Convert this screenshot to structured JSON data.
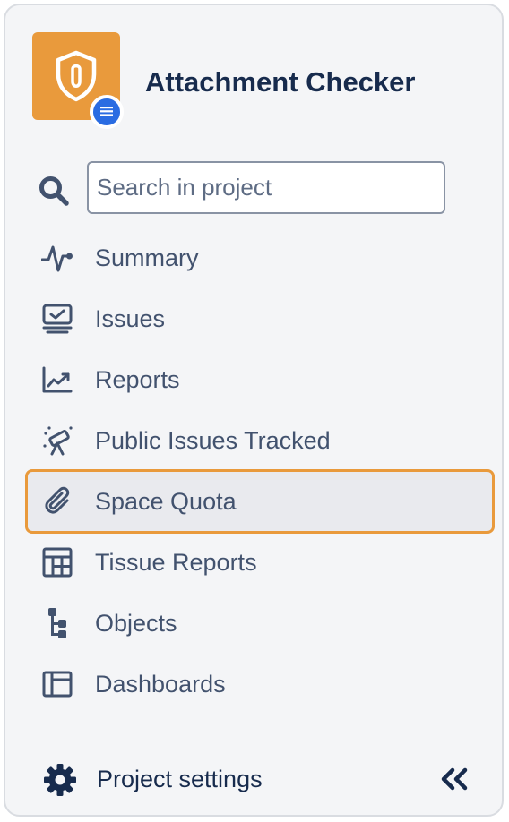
{
  "project": {
    "name": "Attachment Checker",
    "avatar_color": "#e99a3c",
    "badge_color": "#2a6ce2",
    "avatar_icon": "shield-paperclip-icon",
    "badge_icon": "list-icon"
  },
  "search": {
    "placeholder": "Search in project",
    "value": "",
    "icon": "search-icon"
  },
  "nav": {
    "items": [
      {
        "label": "Summary",
        "icon": "pulse-icon"
      },
      {
        "label": "Issues",
        "icon": "monitor-check-icon"
      },
      {
        "label": "Reports",
        "icon": "chart-icon"
      },
      {
        "label": "Public Issues Tracked",
        "icon": "telescope-icon"
      },
      {
        "label": "Space Quota",
        "icon": "paperclip-icon",
        "active": true
      },
      {
        "label": "Tissue Reports",
        "icon": "table-icon"
      },
      {
        "label": "Objects",
        "icon": "hierarchy-icon"
      },
      {
        "label": "Dashboards",
        "icon": "dashboard-icon"
      }
    ]
  },
  "footer": {
    "settings_label": "Project settings",
    "settings_icon": "gear-icon",
    "collapse_icon": "double-chevron-left-icon"
  },
  "colors": {
    "panel_bg": "#f4f5f7",
    "text": "#42526e",
    "heading": "#172b4d",
    "active_border": "#e99a3c"
  }
}
